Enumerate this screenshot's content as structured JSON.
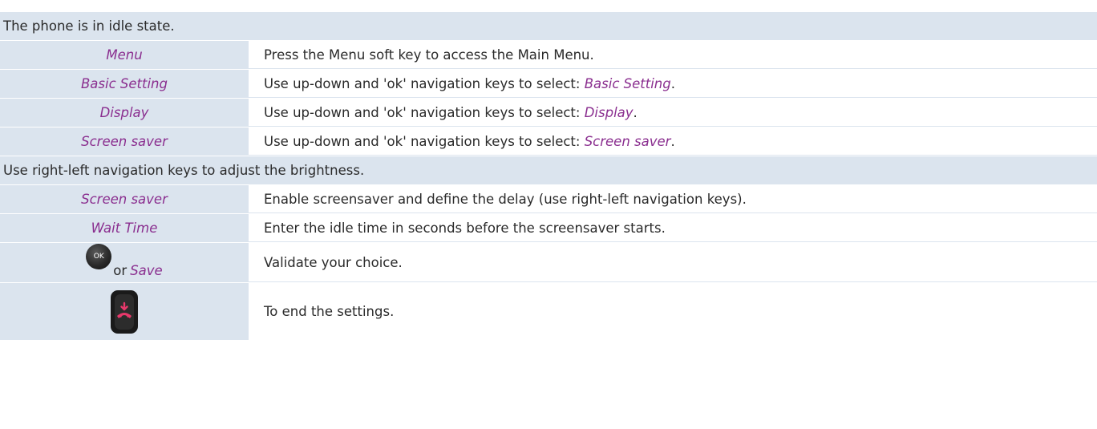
{
  "header_idle": "The phone is in idle state.",
  "header_brightness": "Use right-left navigation keys to adjust the brightness.",
  "steps": [
    {
      "key": "Menu",
      "desc": "Press the Menu soft key to access the Main Menu."
    },
    {
      "key": "Basic Setting",
      "desc_prefix": "Use up-down and 'ok' navigation keys to select: ",
      "desc_kw": "Basic Setting",
      "desc_suffix": "."
    },
    {
      "key": "Display",
      "desc_prefix": "Use up-down and 'ok' navigation keys to select: ",
      "desc_kw": "Display",
      "desc_suffix": "."
    },
    {
      "key": "Screen saver",
      "desc_prefix": "Use up-down and 'ok' navigation keys to select: ",
      "desc_kw": "Screen saver",
      "desc_suffix": "."
    }
  ],
  "steps2": [
    {
      "key": "Screen saver",
      "desc": "Enable screensaver and define the delay (use right-left navigation keys)."
    },
    {
      "key": "Wait Time",
      "desc": "Enter the idle time in seconds before the screensaver starts."
    }
  ],
  "validate": {
    "ok_label": "OK",
    "or": "or",
    "save": "Save",
    "desc": "Validate your choice."
  },
  "end": {
    "desc": "To end the settings."
  },
  "colors": {
    "header_bg": "#dbe4ee",
    "keyword": "#8a2e8f",
    "end_icon": "#e8386b"
  },
  "icons": {
    "ok": "ok-key-icon",
    "end": "end-call-key-icon"
  }
}
